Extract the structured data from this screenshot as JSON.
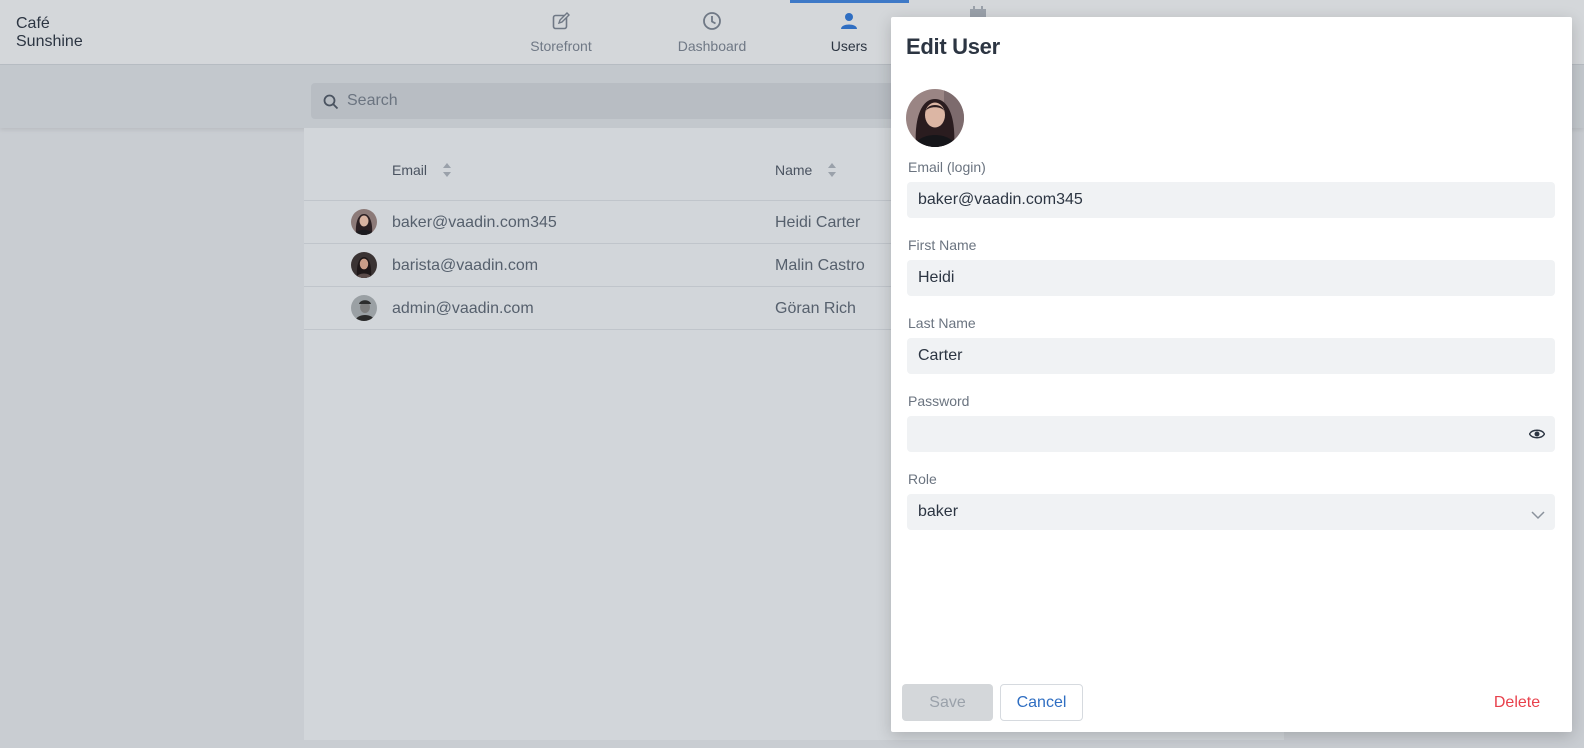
{
  "app": {
    "brand_line1": "Café",
    "brand_line2": "Sunshine"
  },
  "nav": {
    "tabs": [
      {
        "label": "Storefront",
        "icon": "edit-icon"
      },
      {
        "label": "Dashboard",
        "icon": "clock-icon"
      },
      {
        "label": "Users",
        "icon": "user-icon",
        "active": true
      }
    ]
  },
  "search": {
    "placeholder": "Search"
  },
  "grid": {
    "columns": [
      "Email",
      "Name"
    ],
    "rows": [
      {
        "email": "baker@vaadin.com345",
        "name": "Heidi Carter"
      },
      {
        "email": "barista@vaadin.com",
        "name": "Malin Castro"
      },
      {
        "email": "admin@vaadin.com",
        "name": "Göran Rich"
      }
    ]
  },
  "dialog": {
    "title": "Edit User",
    "fields": {
      "email_label": "Email (login)",
      "email_value": "baker@vaadin.com345",
      "first_name_label": "First Name",
      "first_name_value": "Heidi",
      "last_name_label": "Last Name",
      "last_name_value": "Carter",
      "password_label": "Password",
      "password_value": "",
      "role_label": "Role",
      "role_value": "baker"
    },
    "buttons": {
      "save": "Save",
      "cancel": "Cancel",
      "delete": "Delete"
    }
  },
  "colors": {
    "accent": "#2f6ec2",
    "danger": "#e8414c",
    "overlay": "#c9cdd2"
  }
}
